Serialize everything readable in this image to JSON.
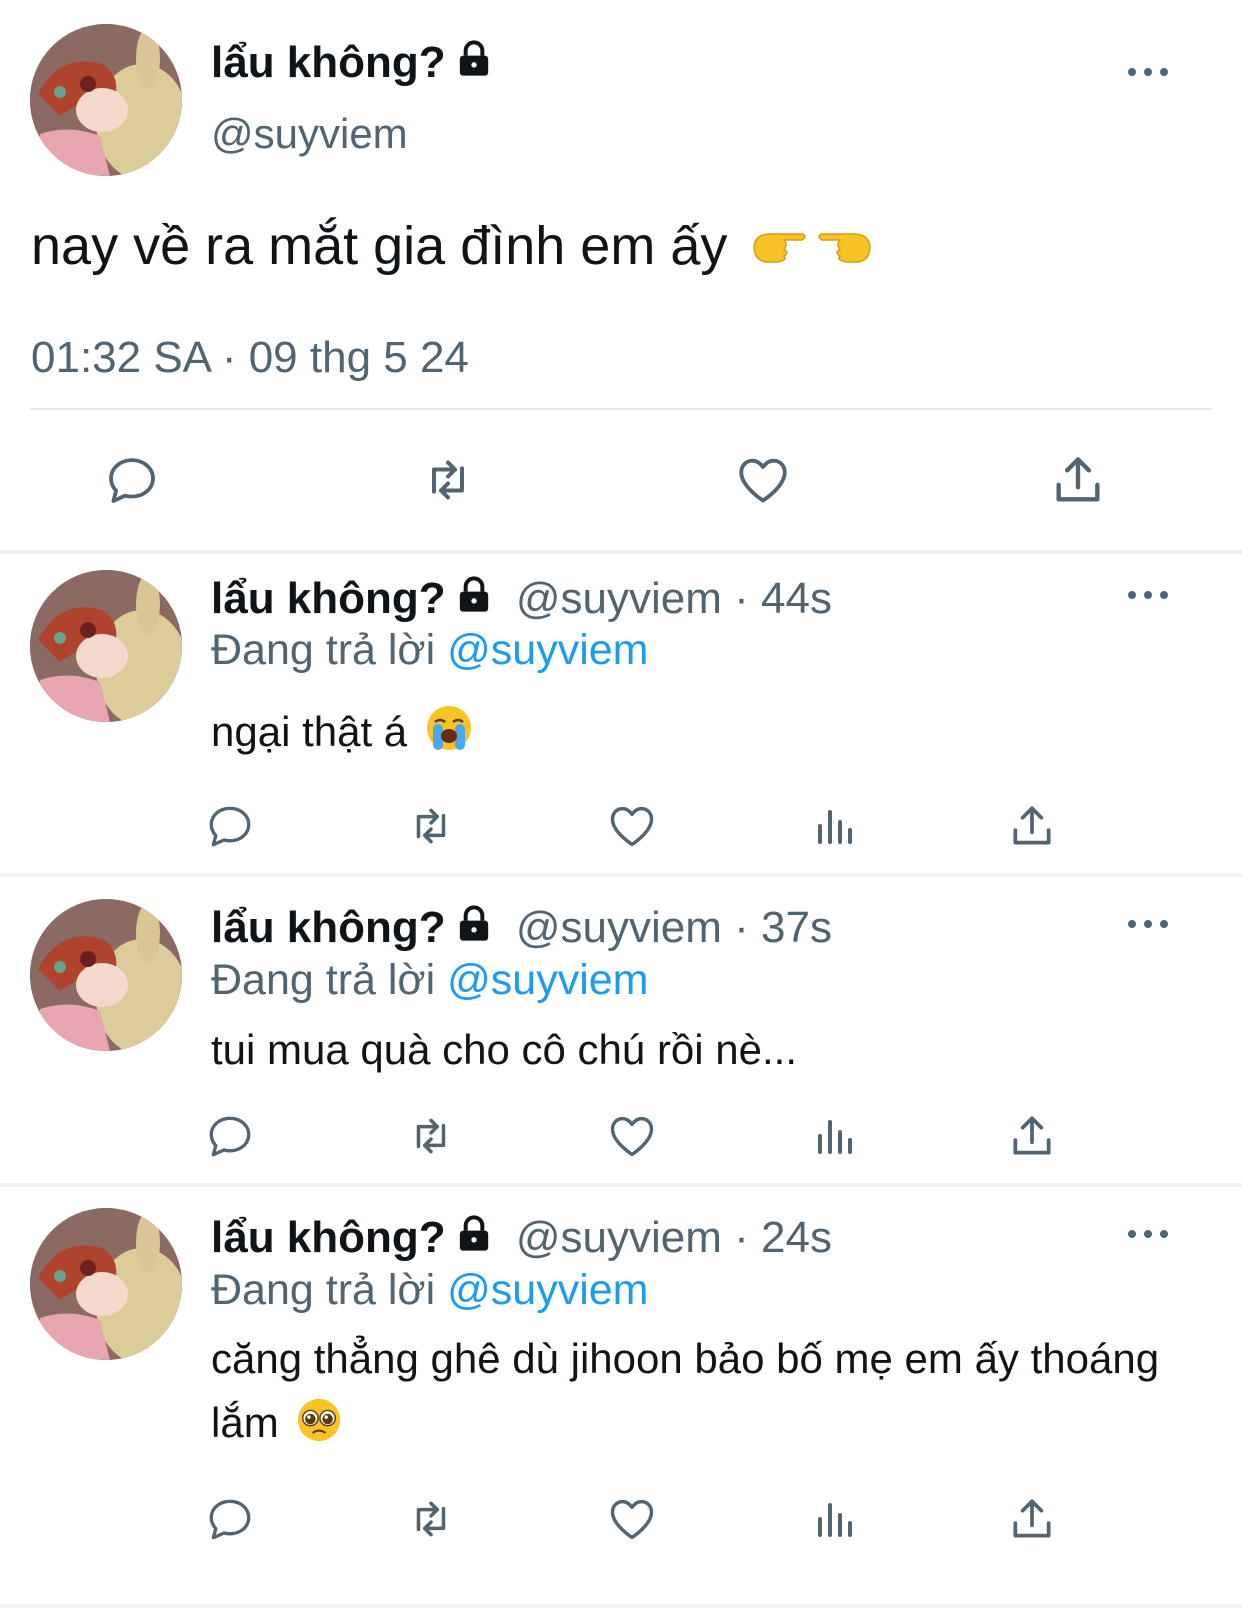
{
  "colors": {
    "text": "#0f1419",
    "secondary": "#536471",
    "link": "#1d9bf0",
    "divider": "#eff1f3"
  },
  "main_tweet": {
    "name": "lẩu không?",
    "handle": "@suyviem",
    "text": "nay về ra mắt gia đình em ấy",
    "emoji": [
      "backhand-index-pointing-right",
      "backhand-index-pointing-left"
    ],
    "timestamp": "01:32 SA · 09 thg 5 24",
    "actions": [
      "reply-icon",
      "retweet-icon",
      "like-icon",
      "share-icon"
    ]
  },
  "replies": [
    {
      "name": "lẩu không?",
      "handle_time": "@suyviem · 44s",
      "replying_prefix": "Đang trả lời",
      "replying_to": "@suyviem",
      "text": "ngại thật á",
      "emoji": "loudly-crying-face"
    },
    {
      "name": "lẩu không?",
      "handle_time": "@suyviem · 37s",
      "replying_prefix": "Đang trả lời",
      "replying_to": "@suyviem",
      "text": "tui mua quà cho cô chú rồi nè...",
      "emoji": ""
    },
    {
      "name": "lẩu không?",
      "handle_time": "@suyviem · 24s",
      "replying_prefix": "Đang trả lời",
      "replying_to": "@suyviem",
      "text": "căng thẳng ghê dù jihoon bảo bố mẹ em ấy thoáng lắm",
      "emoji": "pleading-face"
    }
  ]
}
